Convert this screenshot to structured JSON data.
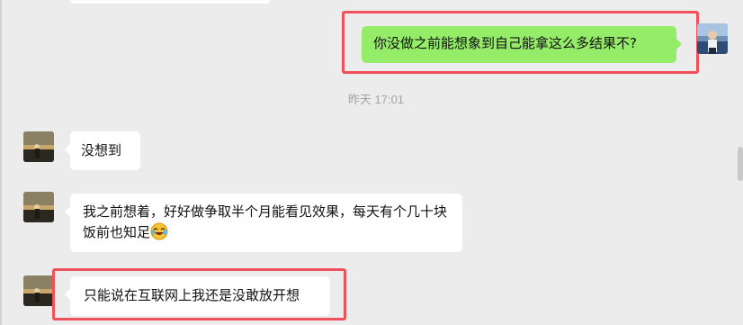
{
  "colors": {
    "background": "#ececec",
    "incoming_bubble": "#ffffff",
    "outgoing_bubble": "#95ec69",
    "highlight": "#f0505a",
    "timestamp": "#a3a3a3"
  },
  "messages": [
    {
      "sender": "self",
      "text": "你没做之前能想象到自己能拿这么多结果不?"
    },
    {
      "sender": "contact",
      "text": "没想到"
    },
    {
      "sender": "contact",
      "text": "我之前想着，好好做争取半个月能看见效果，每天有个几十块饭前也知足",
      "emoji": "laughing-crying-emoji"
    },
    {
      "sender": "contact",
      "text": "只能说在互联网上我还是没敢放开想"
    }
  ],
  "timestamp": "昨天 17:01",
  "icons": {
    "self_avatar": "user-avatar-self",
    "contact_avatar": "user-avatar-contact"
  }
}
